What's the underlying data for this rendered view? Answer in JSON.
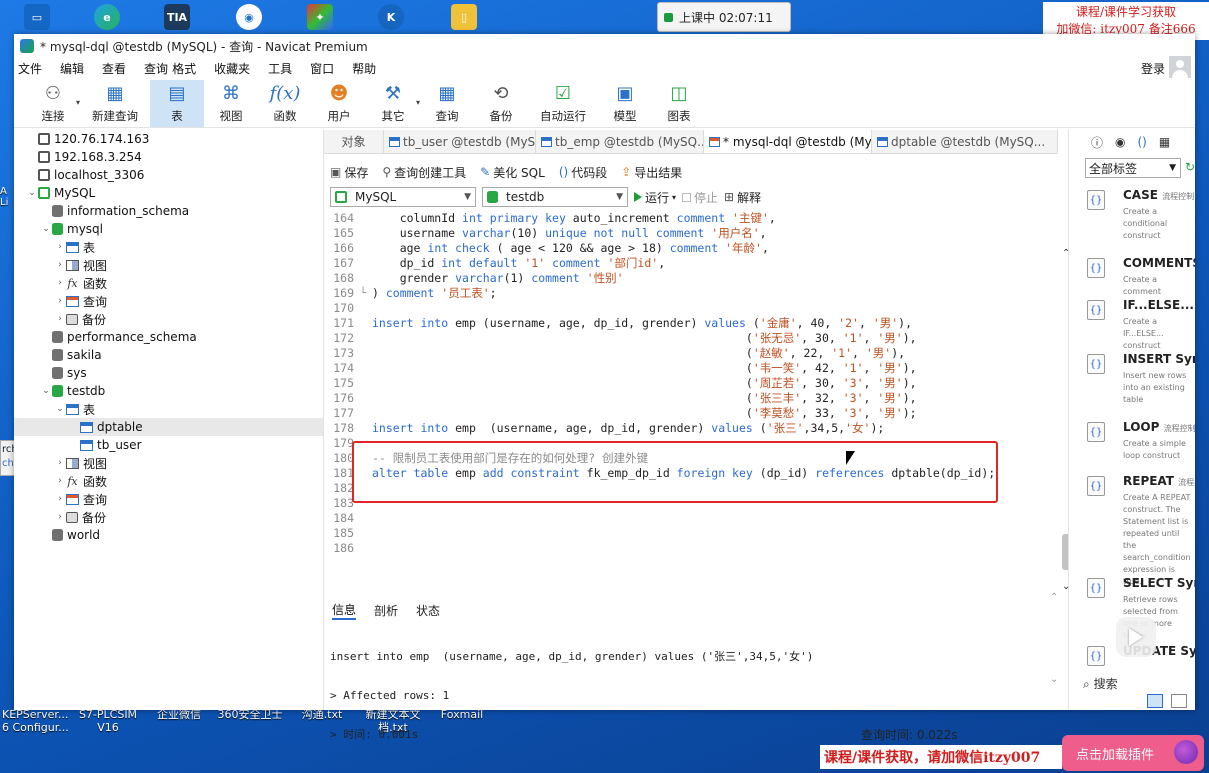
{
  "desktop": {
    "clock": "上课中 02:07:11",
    "banner_top_line1": "课程/课件学习获取",
    "banner_top_line2": "加微信: itzy007 备注666",
    "banner_bottom": "课程/课件获取，请加微信itzy007",
    "pink_button": "点击加载插件",
    "taskbar_icons": [
      {
        "label": "TIA",
        "color": "#1b3a5c"
      },
      {
        "label": "K",
        "color": "#1665c0"
      }
    ],
    "desktop_labels": [
      {
        "text": "KEPServer...\n6 Configur..."
      },
      {
        "text": "S7-PLCSIM\nV16"
      },
      {
        "text": "企业微信"
      },
      {
        "text": "360安全卫士"
      },
      {
        "text": "沟通.txt"
      },
      {
        "text": "新建文本文\n档.txt"
      },
      {
        "text": "Foxmail"
      }
    ],
    "search_popup_line1": "rch",
    "search_popup_line2": "chView"
  },
  "window": {
    "title": "* mysql-dql @testdb (MySQL) - 查询 - Navicat Premium",
    "menu": [
      "文件",
      "编辑",
      "查看",
      "查询",
      "格式",
      "收藏夹",
      "工具",
      "窗口",
      "帮助"
    ],
    "login": "登录",
    "toolbar": [
      {
        "label": "连接",
        "icon": "plug-icon"
      },
      {
        "label": "新建查询",
        "icon": "new-query-icon"
      },
      {
        "label": "表",
        "icon": "table-icon"
      },
      {
        "label": "视图",
        "icon": "view-icon"
      },
      {
        "label": "函数",
        "icon": "function-icon"
      },
      {
        "label": "用户",
        "icon": "user-icon"
      },
      {
        "label": "其它",
        "icon": "tools-icon"
      },
      {
        "label": "查询",
        "icon": "query-icon"
      },
      {
        "label": "备份",
        "icon": "backup-icon"
      },
      {
        "label": "自动运行",
        "icon": "schedule-icon"
      },
      {
        "label": "模型",
        "icon": "model-icon"
      },
      {
        "label": "图表",
        "icon": "chart-icon"
      }
    ]
  },
  "tree": [
    {
      "text": "120.76.174.163",
      "type": "conn",
      "indent": 0
    },
    {
      "text": "192.168.3.254",
      "type": "conn",
      "indent": 0
    },
    {
      "text": "localhost_3306",
      "type": "conn",
      "indent": 0
    },
    {
      "text": "MySQL",
      "type": "conn-green",
      "indent": 0,
      "arrow": "open"
    },
    {
      "text": "information_schema",
      "type": "db",
      "indent": 1
    },
    {
      "text": "mysql",
      "type": "db-green",
      "indent": 1,
      "arrow": "open"
    },
    {
      "text": "表",
      "type": "table",
      "indent": 2,
      "arrow": "closed"
    },
    {
      "text": "视图",
      "type": "view",
      "indent": 2,
      "arrow": "closed"
    },
    {
      "text": "函数",
      "type": "fx",
      "indent": 2,
      "arrow": "closed"
    },
    {
      "text": "查询",
      "type": "query",
      "indent": 2,
      "arrow": "closed"
    },
    {
      "text": "备份",
      "type": "backup",
      "indent": 2,
      "arrow": "closed"
    },
    {
      "text": "performance_schema",
      "type": "db",
      "indent": 1
    },
    {
      "text": "sakila",
      "type": "db",
      "indent": 1
    },
    {
      "text": "sys",
      "type": "db",
      "indent": 1
    },
    {
      "text": "testdb",
      "type": "db-green",
      "indent": 1,
      "arrow": "open"
    },
    {
      "text": "表",
      "type": "table",
      "indent": 2,
      "arrow": "open"
    },
    {
      "text": "dptable",
      "type": "table",
      "indent": 3,
      "selected": true
    },
    {
      "text": "tb_user",
      "type": "table",
      "indent": 3
    },
    {
      "text": "视图",
      "type": "view",
      "indent": 2,
      "arrow": "closed"
    },
    {
      "text": "函数",
      "type": "fx",
      "indent": 2,
      "arrow": "closed"
    },
    {
      "text": "查询",
      "type": "query",
      "indent": 2,
      "arrow": "closed"
    },
    {
      "text": "备份",
      "type": "backup",
      "indent": 2,
      "arrow": "closed"
    },
    {
      "text": "world",
      "type": "db",
      "indent": 1
    }
  ],
  "tabs": [
    {
      "label": "对象",
      "icon": "none"
    },
    {
      "label": "tb_user @testdb (MySQL...",
      "icon": "table"
    },
    {
      "label": "tb_emp @testdb (MySQ...",
      "icon": "table"
    },
    {
      "label": "* mysql-dql @testdb (My...",
      "icon": "query",
      "active": true
    },
    {
      "label": "dptable @testdb (MySQ...",
      "icon": "table"
    }
  ],
  "editor_toolbar": {
    "save": "保存",
    "query_builder": "查询创建工具",
    "beautify": "美化 SQL",
    "code_snippet": "代码段",
    "export": "导出结果"
  },
  "selectors": {
    "connection": "MySQL",
    "database": "testdb",
    "run": "运行",
    "stop": "停止",
    "explain": "解释"
  },
  "code_lines": [
    {
      "n": "164",
      "html": "    columnId <span class=\"kw\">int primary key</span> auto_increment <span class=\"kw\">comment</span> <span class=\"str\">'主键'</span>,"
    },
    {
      "n": "165",
      "html": "    username <span class=\"kw\">varchar</span>(10) <span class=\"kw\">unique not null comment</span> <span class=\"str\">'用户名'</span>,"
    },
    {
      "n": "166",
      "html": "    age <span class=\"kw\">int check</span> ( age &lt; 120 &amp;&amp; age &gt; 18) <span class=\"kw\">comment</span> <span class=\"str\">'年龄'</span>,"
    },
    {
      "n": "167",
      "html": "    dp_id <span class=\"kw\">int default</span> <span class=\"str\">'1'</span> <span class=\"kw\">comment</span> <span class=\"str\">'部门id'</span>,"
    },
    {
      "n": "168",
      "html": "    grender <span class=\"kw\">varchar</span>(1) <span class=\"kw\">comment</span> <span class=\"str\">'性别'</span>"
    },
    {
      "n": "169",
      "html": ") <span class=\"kw\">comment</span> <span class=\"str\">'员工表'</span>;",
      "fold": "end"
    },
    {
      "n": "170",
      "html": ""
    },
    {
      "n": "171",
      "html": "<span class=\"kw\">insert into</span> emp (username, age, dp_id, grender) <span class=\"kw\">values</span> (<span class=\"str\">'金庸'</span>, 40, <span class=\"str\">'2'</span>, <span class=\"str\">'男'</span>),"
    },
    {
      "n": "172",
      "html": "                                                      (<span class=\"str\">'张无忌'</span>, 30, <span class=\"str\">'1'</span>, <span class=\"str\">'男'</span>),"
    },
    {
      "n": "173",
      "html": "                                                      (<span class=\"str\">'赵敏'</span>, 22, <span class=\"str\">'1'</span>, <span class=\"str\">'男'</span>),"
    },
    {
      "n": "174",
      "html": "                                                      (<span class=\"str\">'韦一笑'</span>, 42, <span class=\"str\">'1'</span>, <span class=\"str\">'男'</span>),"
    },
    {
      "n": "175",
      "html": "                                                      (<span class=\"str\">'周芷若'</span>, 30, <span class=\"str\">'3'</span>, <span class=\"str\">'男'</span>),"
    },
    {
      "n": "176",
      "html": "                                                      (<span class=\"str\">'张三丰'</span>, 32, <span class=\"str\">'3'</span>, <span class=\"str\">'男'</span>),"
    },
    {
      "n": "177",
      "html": "                                                      (<span class=\"str\">'李莫愁'</span>, 33, <span class=\"str\">'3'</span>, <span class=\"str\">'男'</span>);"
    },
    {
      "n": "178",
      "html": "<span class=\"kw\">insert into</span> emp  (username, age, dp_id, grender) <span class=\"kw\">values</span> (<span class=\"str\">'张三'</span>,34,5,<span class=\"str\">'女'</span>);"
    },
    {
      "n": "179",
      "html": ""
    },
    {
      "n": "180",
      "html": "<span class=\"cmt\">-- 限制员工表使用部门是存在的如何处理? 创建外键</span>"
    },
    {
      "n": "181",
      "html": "<span class=\"kw\">alter table</span> emp <span class=\"kw\">add constraint</span> fk_emp_dp_id <span class=\"kw\">foreign key</span> (dp_id) <span class=\"kw\">references</span> dptable(dp_id);"
    },
    {
      "n": "182",
      "html": ""
    },
    {
      "n": "183",
      "html": ""
    },
    {
      "n": "184",
      "html": ""
    },
    {
      "n": "185",
      "html": ""
    },
    {
      "n": "186",
      "html": ""
    }
  ],
  "results": {
    "tabs": [
      "信息",
      "剖析",
      "状态"
    ],
    "lines": [
      "insert into emp  (username, age, dp_id, grender) values ('张三',34,5,'女')",
      "> Affected rows: 1",
      "> 时间: 0.001s"
    ]
  },
  "status": {
    "query_time": "查询时间: 0.022s"
  },
  "right_panel": {
    "filter": "全部标签",
    "search": "搜索",
    "snippets": [
      {
        "title": "CASE",
        "tag": "流程控制",
        "desc": "Create a conditional construct"
      },
      {
        "title": "COMMENTS",
        "tag": "",
        "desc": "Create a comment"
      },
      {
        "title": "IF...ELSE...",
        "tag": "流程",
        "desc": "Create a IF...ELSE... construct"
      },
      {
        "title": "INSERT Synta",
        "tag": "",
        "desc": "Insert new rows into an existing table"
      },
      {
        "title": "LOOP",
        "tag": "流程控制",
        "desc": "Create a simple loop construct"
      },
      {
        "title": "REPEAT",
        "tag": "流程控",
        "desc": "Create A REPEAT construct. The Statement list is repeated until the search_condition expression is true."
      },
      {
        "title": "SELECT Synta",
        "tag": "",
        "desc": "Retrieve rows selected from one or more tables"
      },
      {
        "title": "UPDATE Synt",
        "tag": "",
        "desc": ""
      }
    ]
  }
}
